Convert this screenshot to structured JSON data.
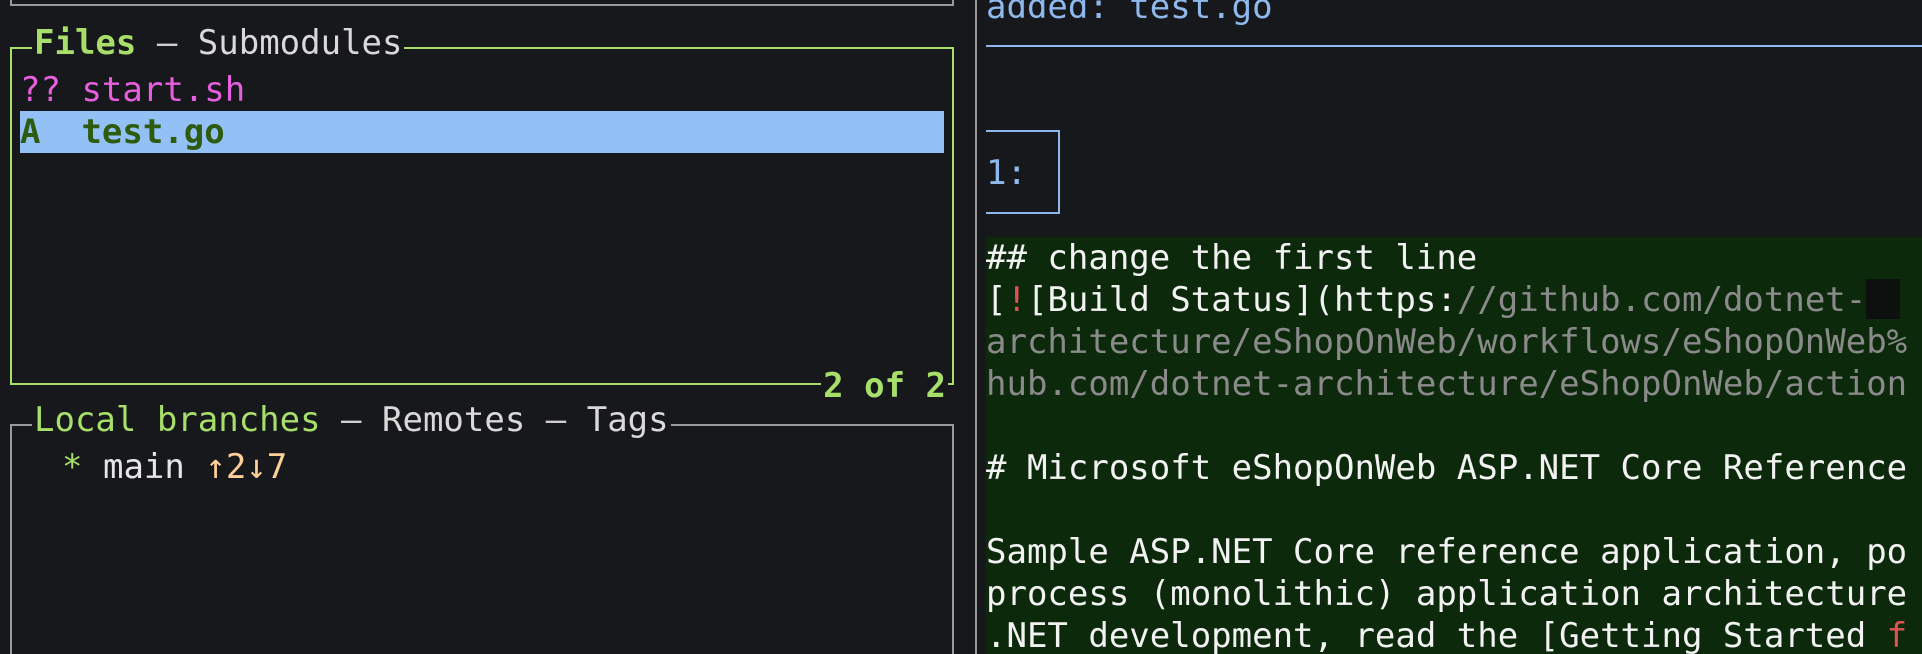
{
  "files_panel": {
    "title_active": "Files",
    "title_separator": " – ",
    "title_other": "Submodules",
    "rows": [
      {
        "status": "??",
        "name": "start.sh"
      },
      {
        "status": "A ",
        "name": "test.go"
      }
    ],
    "footer": "2 of 2"
  },
  "branches_panel": {
    "title_active": "Local branches",
    "sep1": " – ",
    "remotes": "Remotes",
    "sep2": " – ",
    "tags": "Tags",
    "branches": [
      {
        "marker": "*",
        "name": "main",
        "ahead_behind": "↑2↓7"
      }
    ]
  },
  "diff": {
    "header": "added: test.go",
    "line_number": "1:",
    "lines": {
      "l1": "## change the first line",
      "l2_a": "[",
      "l2_bang": "!",
      "l2_b": "[Build Status](https:",
      "l2_dim": "//github.com/dotnet-",
      "l3": "architecture/eShopOnWeb/workflows/eShopOnWeb%",
      "l4": "hub.com/dotnet-architecture/eShopOnWeb/action",
      "l6": "# Microsoft eShopOnWeb ASP.NET Core Reference",
      "l8": "Sample ASP.NET Core reference application, po",
      "l9": "process (monolithic) application architecture",
      "l10_a": ".NET development, read the [Getting Started ",
      "l10_red": "f"
    }
  },
  "colors": {
    "accent_green": "#a8df6b",
    "selection_blue": "#93c1f5",
    "untracked_magenta": "#e75ede",
    "diff_blue": "#8fb9ec",
    "added_bg": "#0c2a0b"
  }
}
